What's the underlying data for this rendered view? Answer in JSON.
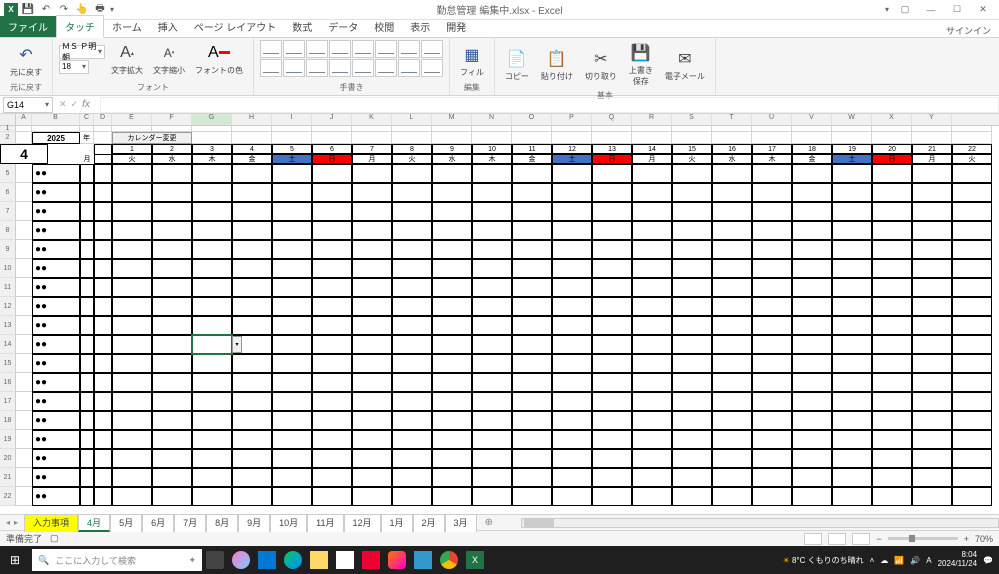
{
  "app": {
    "title": "勤怠管理 編集中.xlsx - Excel",
    "signin": "サインイン"
  },
  "qat": {
    "save": "💾",
    "undo": "↶",
    "redo": "↷",
    "touch": "👆",
    "print": "🖶"
  },
  "tabs": {
    "file": "ファイル",
    "touch": "タッチ",
    "home": "ホーム",
    "insert": "挿入",
    "pagelayout": "ページ レイアウト",
    "formulas": "数式",
    "data": "データ",
    "review": "校閲",
    "view": "表示",
    "developer": "開発"
  },
  "ribbon": {
    "undo_group": "元に戻す",
    "undo_btn": "元に戻す",
    "font_group": "フォント",
    "font_name": "ＭＳ Ｐ明朝",
    "font_size": "18",
    "zoom_in": "文字拡大",
    "zoom_out": "文字縮小",
    "font_color": "フォントの色",
    "ink_group": "手書き",
    "edit_group": "編集",
    "fill": "フィル",
    "basic_group": "基本",
    "copy": "コピー",
    "paste": "貼り付け",
    "cut": "切り取り",
    "overwrite_save": "上書き\n保存",
    "email": "電子メール"
  },
  "namebox": "G14",
  "sheet": {
    "year": "2025",
    "year_label": "年",
    "month": "4",
    "month_label": "月",
    "calendar_btn": "カレンダー変更",
    "dates": [
      "1",
      "2",
      "3",
      "4",
      "5",
      "6",
      "7",
      "8",
      "9",
      "10",
      "11",
      "12",
      "13",
      "14",
      "15",
      "16",
      "17",
      "18",
      "19",
      "20",
      "21",
      "22"
    ],
    "days": [
      "火",
      "水",
      "木",
      "金",
      "土",
      "日",
      "月",
      "火",
      "水",
      "木",
      "金",
      "土",
      "日",
      "月",
      "火",
      "水",
      "木",
      "金",
      "土",
      "日",
      "月",
      "火"
    ],
    "weekend_idx": [
      4,
      5,
      11,
      12,
      18,
      19
    ],
    "row_label": "●●",
    "row_count": 18
  },
  "col_letters": [
    "A",
    "B",
    "C",
    "D",
    "E",
    "F",
    "G",
    "H",
    "I",
    "J",
    "K",
    "L",
    "M",
    "N",
    "O",
    "P",
    "Q",
    "R",
    "S",
    "T",
    "U",
    "V",
    "W",
    "X",
    "Y"
  ],
  "sheet_tabs": [
    "入力事項",
    "4月",
    "5月",
    "6月",
    "7月",
    "8月",
    "9月",
    "10月",
    "11月",
    "12月",
    "1月",
    "2月",
    "3月"
  ],
  "active_sheet_tab": 1,
  "status": {
    "ready": "準備完了",
    "zoom": "70%"
  },
  "taskbar": {
    "search_placeholder": "ここに入力して検索",
    "weather": "8°C くもりのち晴れ",
    "time": "8:04",
    "date": "2024/11/24"
  }
}
